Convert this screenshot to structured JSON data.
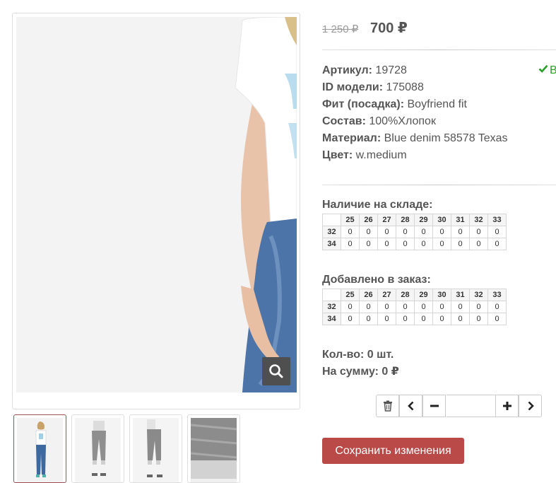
{
  "product": {
    "old_price": "1 250 ₽",
    "new_price": "700 ₽",
    "stock_status": "В",
    "properties": [
      {
        "label": "Артикул:",
        "value": " 19728"
      },
      {
        "label": "ID модели:",
        "value": " 175088"
      },
      {
        "label": "Фит (посадка):",
        "value": " Boyfriend fit"
      },
      {
        "label": "Состав:",
        "value": " 100%Хлопок"
      },
      {
        "label": "Материал:",
        "value": " Blue denim 58578 Texas"
      },
      {
        "label": "Цвет:",
        "value": " w.medium"
      }
    ]
  },
  "stock": {
    "title": "Наличие на складе:",
    "sizes": [
      "25",
      "26",
      "27",
      "28",
      "29",
      "30",
      "31",
      "32",
      "33"
    ],
    "rows": [
      {
        "length": "32",
        "values": [
          "0",
          "0",
          "0",
          "0",
          "0",
          "0",
          "0",
          "0",
          "0"
        ]
      },
      {
        "length": "34",
        "values": [
          "0",
          "0",
          "0",
          "0",
          "0",
          "0",
          "0",
          "0",
          "0"
        ]
      }
    ]
  },
  "order": {
    "title": "Добавлено в заказ:",
    "sizes": [
      "25",
      "26",
      "27",
      "28",
      "29",
      "30",
      "31",
      "32",
      "33"
    ],
    "rows": [
      {
        "length": "32",
        "values": [
          "0",
          "0",
          "0",
          "0",
          "0",
          "0",
          "0",
          "0",
          "0"
        ]
      },
      {
        "length": "34",
        "values": [
          "0",
          "0",
          "0",
          "0",
          "0",
          "0",
          "0",
          "0",
          "0"
        ]
      }
    ]
  },
  "summary": {
    "quantity": "Кол-во: 0 шт.",
    "total": "На сумму: 0 ₽"
  },
  "quantity_input": {
    "value": ""
  },
  "actions": {
    "save_label": "Сохранить изменения"
  },
  "icons": {
    "zoom": "search-icon",
    "delete": "trash-icon",
    "prev": "chevron-left-icon",
    "minus": "minus-icon",
    "plus": "plus-icon",
    "next": "chevron-right-icon",
    "stock": "check-icon"
  },
  "colors": {
    "accent": "#b94a48",
    "in_stock": "#2aa02a",
    "active_thumb_border": "#a05050"
  }
}
